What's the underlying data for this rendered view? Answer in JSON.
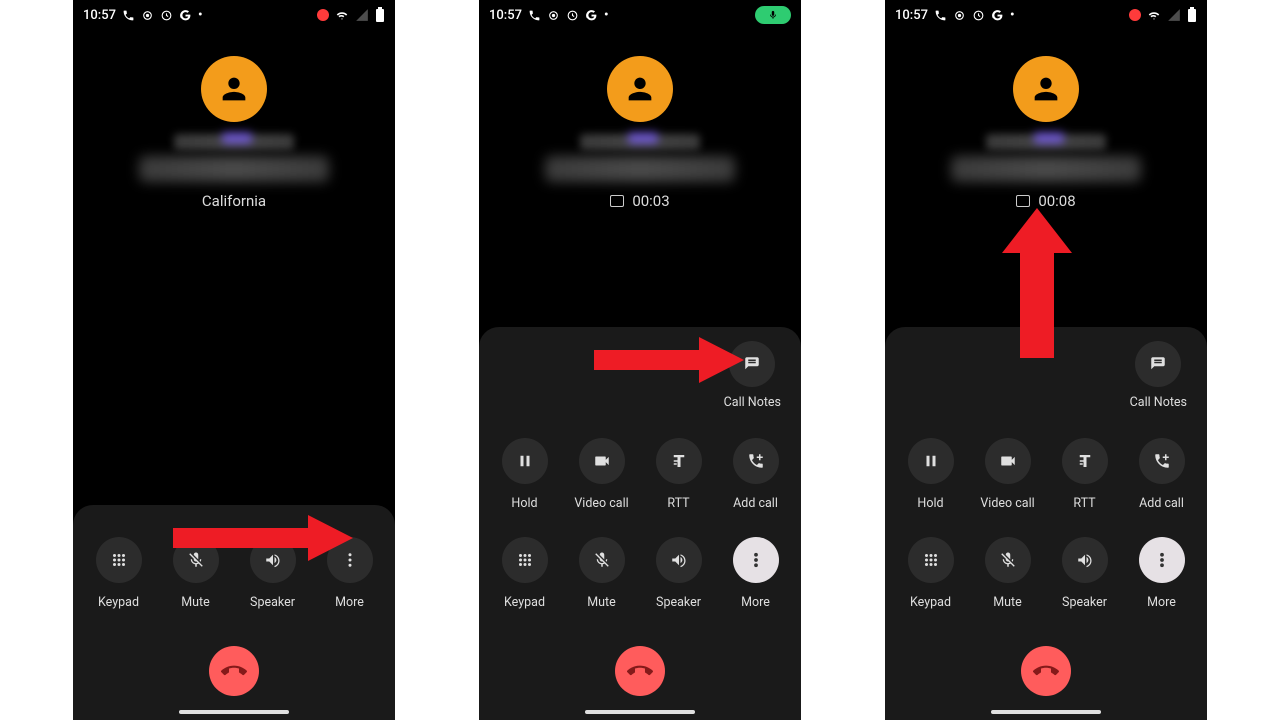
{
  "statusbar": {
    "time": "10:57",
    "dot": "•"
  },
  "phone1": {
    "meta": "California",
    "buttons": {
      "keypad": "Keypad",
      "mute": "Mute",
      "speaker": "Speaker",
      "more": "More"
    }
  },
  "phone2": {
    "meta_timer": "00:03",
    "call_notes_label": "Call Notes",
    "buttons_top": {
      "hold": "Hold",
      "video": "Video call",
      "rtt": "RTT",
      "addcall": "Add call"
    },
    "buttons_bottom": {
      "keypad": "Keypad",
      "mute": "Mute",
      "speaker": "Speaker",
      "more": "More"
    }
  },
  "phone3": {
    "meta_timer": "00:08",
    "call_notes_label": "Call Notes",
    "buttons_top": {
      "hold": "Hold",
      "video": "Video call",
      "rtt": "RTT",
      "addcall": "Add call"
    },
    "buttons_bottom": {
      "keypad": "Keypad",
      "mute": "Mute",
      "speaker": "Speaker",
      "more": "More"
    }
  }
}
